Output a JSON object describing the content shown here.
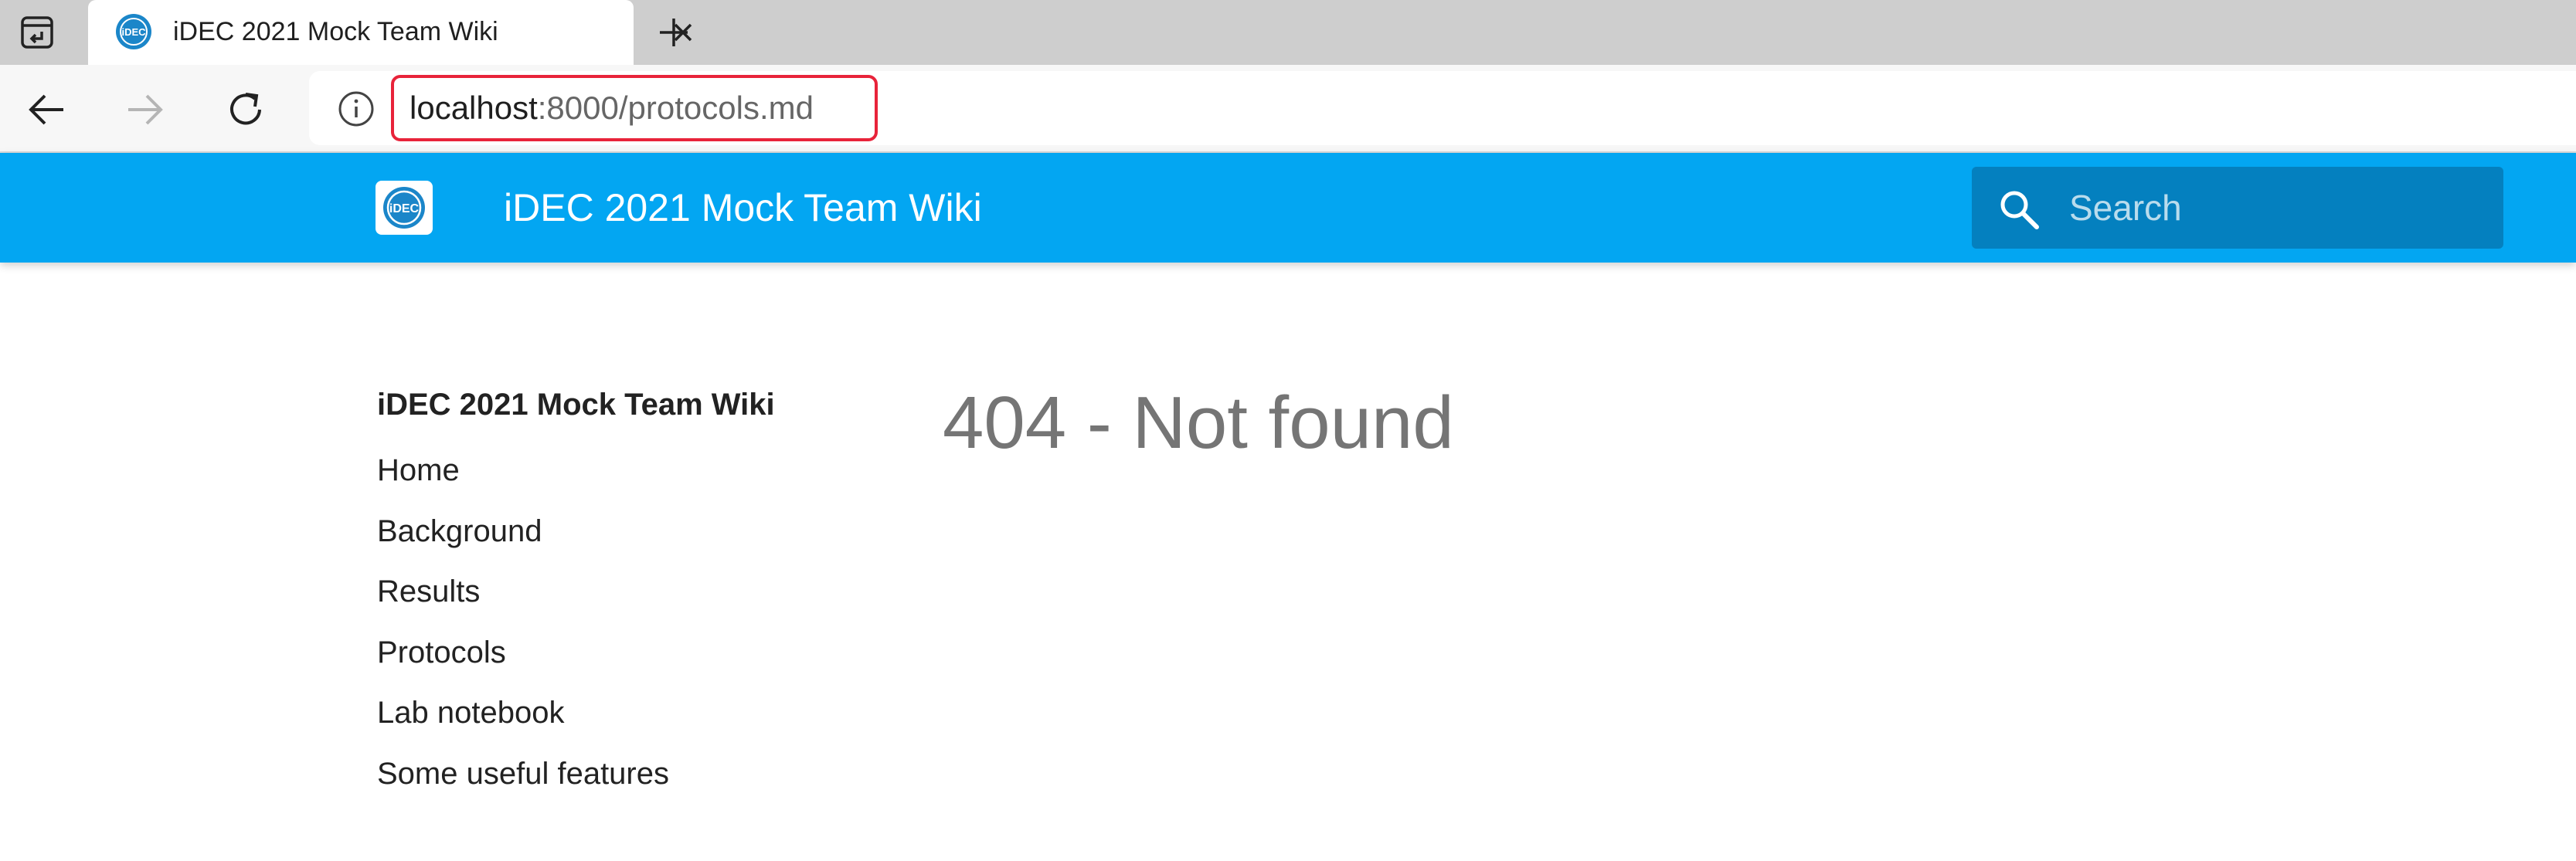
{
  "browser": {
    "tab": {
      "title": "iDEC 2021 Mock Team Wiki",
      "favicon_text": "iDEC"
    },
    "address": {
      "host": "localhost",
      "rest": ":8000/protocols.md"
    },
    "icons": {
      "tab_actions": "tab-actions-icon",
      "close": "close-icon",
      "new_tab": "plus-icon",
      "back": "back-arrow-icon",
      "forward": "forward-arrow-icon",
      "reload": "reload-icon",
      "site_info": "info-icon"
    }
  },
  "site": {
    "title": "iDEC 2021 Mock Team Wiki",
    "logo_text": "iDEC",
    "search": {
      "placeholder": "Search"
    },
    "colors": {
      "header": "#03a6f2",
      "search_bg": "#0480bf",
      "url_highlight": "#e8233a"
    }
  },
  "sidebar": {
    "title": "iDEC 2021 Mock Team Wiki",
    "items": [
      {
        "label": "Home"
      },
      {
        "label": "Background"
      },
      {
        "label": "Results"
      },
      {
        "label": "Protocols"
      },
      {
        "label": "Lab notebook"
      },
      {
        "label": "Some useful features"
      }
    ]
  },
  "main": {
    "heading": "404 - Not found"
  }
}
